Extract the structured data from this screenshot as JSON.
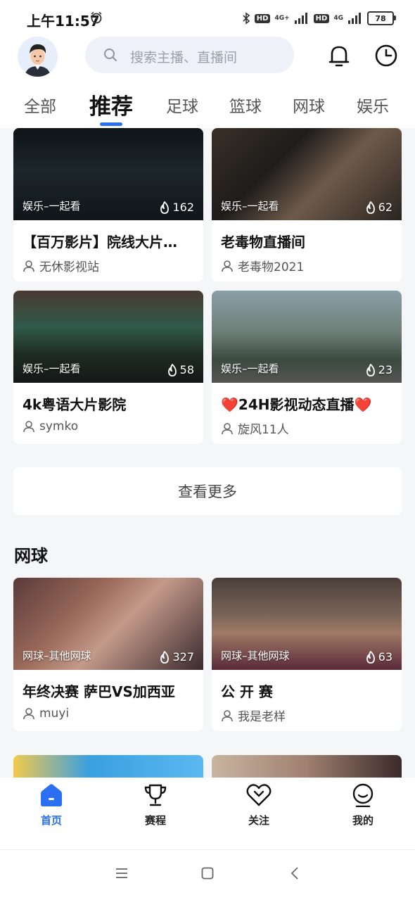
{
  "status_bar": {
    "time": "上午11:57",
    "hd1": "HD",
    "net1": "4G+",
    "hd2": "HD",
    "net2": "4G",
    "battery": "78"
  },
  "search": {
    "placeholder": "搜索主播、直播间"
  },
  "tabs": [
    {
      "label": "全部"
    },
    {
      "label": "推荐"
    },
    {
      "label": "足球"
    },
    {
      "label": "篮球"
    },
    {
      "label": "网球"
    },
    {
      "label": "娱乐"
    }
  ],
  "active_tab": "推荐",
  "cards": [
    {
      "tag": "娱乐–一起看",
      "heat": "162",
      "title": "【百万影片】院线大片…",
      "author": "无休影视站"
    },
    {
      "tag": "娱乐–一起看",
      "heat": "62",
      "title": "老毒物直播间",
      "author": "老毒物2021"
    },
    {
      "tag": "娱乐–一起看",
      "heat": "58",
      "title": "4k粤语大片影院",
      "author": "symko"
    },
    {
      "tag": "娱乐–一起看",
      "heat": "23",
      "title": "❤️24H影视动态直播❤️",
      "author": "旋风11人"
    }
  ],
  "more_button": "查看更多",
  "section": {
    "title": "网球"
  },
  "tennis_cards": [
    {
      "tag": "网球–其他网球",
      "heat": "327",
      "title": "年终决赛 萨巴VS加西亚",
      "author": "muyi"
    },
    {
      "tag": "网球–其他网球",
      "heat": "63",
      "title": "公 开 赛",
      "author": "我是老样"
    }
  ],
  "bottom_nav": [
    {
      "label": "首页",
      "icon": "home-icon"
    },
    {
      "label": "赛程",
      "icon": "trophy-icon"
    },
    {
      "label": "关注",
      "icon": "heart-icon"
    },
    {
      "label": "我的",
      "icon": "profile-icon"
    }
  ],
  "colors": {
    "accent": "#2b6ff2",
    "background": "#f5f6f8"
  }
}
